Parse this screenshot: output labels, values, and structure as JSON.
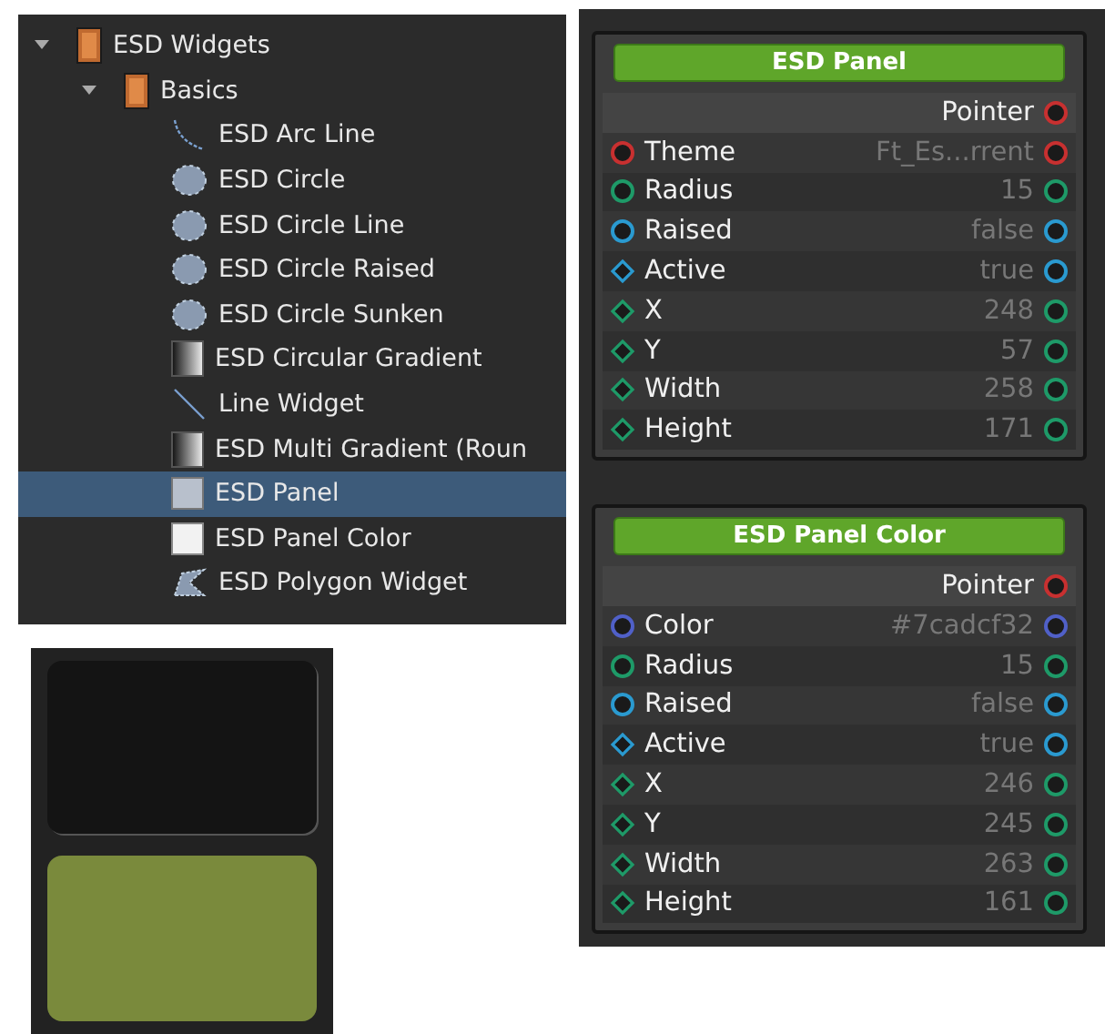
{
  "tree": {
    "items": [
      {
        "label": "ESD Widgets",
        "kind": "folder",
        "expanded": true,
        "selected": false,
        "children": [
          {
            "label": "Basics",
            "kind": "folder",
            "expanded": true,
            "selected": false,
            "children": [
              {
                "label": "ESD Arc Line",
                "kind": "arc",
                "selected": false
              },
              {
                "label": "ESD Circle",
                "kind": "circle",
                "selected": false
              },
              {
                "label": "ESD Circle Line",
                "kind": "circle",
                "selected": false
              },
              {
                "label": "ESD Circle Raised",
                "kind": "circle",
                "selected": false
              },
              {
                "label": "ESD Circle Sunken",
                "kind": "circle",
                "selected": false
              },
              {
                "label": "ESD Circular Gradient",
                "kind": "gradient",
                "selected": false
              },
              {
                "label": "Line Widget",
                "kind": "line",
                "selected": false
              },
              {
                "label": "ESD Multi Gradient (Roun",
                "kind": "gradient",
                "selected": false
              },
              {
                "label": "ESD Panel",
                "kind": "panel",
                "selected": true
              },
              {
                "label": "ESD Panel Color",
                "kind": "panel-light",
                "selected": false
              },
              {
                "label": "ESD Polygon Widget",
                "kind": "polygon",
                "selected": false
              }
            ]
          }
        ]
      }
    ]
  },
  "nodes": [
    {
      "title": "ESD Panel",
      "output": {
        "label": "Pointer",
        "color": "#c83030"
      },
      "ports": [
        {
          "label": "Theme",
          "value": "Ft_Es...rrent",
          "input": {
            "kind": "circle",
            "color": "#c83030"
          },
          "output": {
            "color": "#c83030"
          }
        },
        {
          "label": "Radius",
          "value": "15",
          "input": {
            "kind": "circle",
            "color": "#1e9a68"
          },
          "output": {
            "color": "#1e9a68"
          }
        },
        {
          "label": "Raised",
          "value": "false",
          "input": {
            "kind": "circle",
            "color": "#2a9ad0"
          },
          "output": {
            "color": "#2a9ad0"
          }
        },
        {
          "label": "Active",
          "value": "true",
          "input": {
            "kind": "diamond",
            "color": "#2a9ad0"
          },
          "output": {
            "color": "#2a9ad0"
          }
        },
        {
          "label": "X",
          "value": "248",
          "input": {
            "kind": "diamond",
            "color": "#1e9a68"
          },
          "output": {
            "color": "#1e9a68"
          }
        },
        {
          "label": "Y",
          "value": "57",
          "input": {
            "kind": "diamond",
            "color": "#1e9a68"
          },
          "output": {
            "color": "#1e9a68"
          }
        },
        {
          "label": "Width",
          "value": "258",
          "input": {
            "kind": "diamond",
            "color": "#1e9a68"
          },
          "output": {
            "color": "#1e9a68"
          }
        },
        {
          "label": "Height",
          "value": "171",
          "input": {
            "kind": "diamond",
            "color": "#1e9a68"
          },
          "output": {
            "color": "#1e9a68"
          }
        }
      ]
    },
    {
      "title": "ESD Panel Color",
      "output": {
        "label": "Pointer",
        "color": "#c83030"
      },
      "ports": [
        {
          "label": "Color",
          "value": "#7cadcf32",
          "input": {
            "kind": "circle",
            "color": "#5060c8"
          },
          "output": {
            "color": "#5060c8"
          }
        },
        {
          "label": "Radius",
          "value": "15",
          "input": {
            "kind": "circle",
            "color": "#1e9a68"
          },
          "output": {
            "color": "#1e9a68"
          }
        },
        {
          "label": "Raised",
          "value": "false",
          "input": {
            "kind": "circle",
            "color": "#2a9ad0"
          },
          "output": {
            "color": "#2a9ad0"
          }
        },
        {
          "label": "Active",
          "value": "true",
          "input": {
            "kind": "diamond",
            "color": "#2a9ad0"
          },
          "output": {
            "color": "#2a9ad0"
          }
        },
        {
          "label": "X",
          "value": "246",
          "input": {
            "kind": "diamond",
            "color": "#1e9a68"
          },
          "output": {
            "color": "#1e9a68"
          }
        },
        {
          "label": "Y",
          "value": "245",
          "input": {
            "kind": "diamond",
            "color": "#1e9a68"
          },
          "output": {
            "color": "#1e9a68"
          }
        },
        {
          "label": "Width",
          "value": "263",
          "input": {
            "kind": "diamond",
            "color": "#1e9a68"
          },
          "output": {
            "color": "#1e9a68"
          }
        },
        {
          "label": "Height",
          "value": "161",
          "input": {
            "kind": "diamond",
            "color": "#1e9a68"
          },
          "output": {
            "color": "#1e9a68"
          }
        }
      ]
    }
  ]
}
